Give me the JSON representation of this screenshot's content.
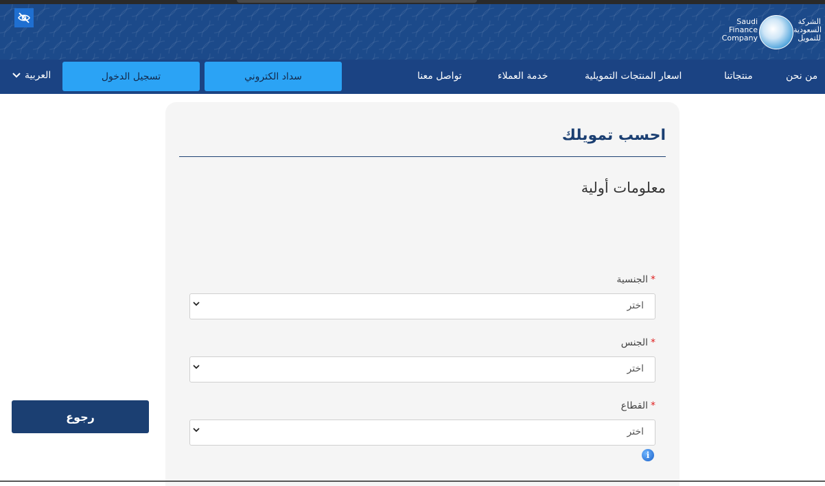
{
  "header": {
    "logo": {
      "arabic_line1": "الشركة",
      "arabic_line2": "السعودية",
      "arabic_line3": "للتمويل",
      "english_line1": "Saudi",
      "english_line2": "Finance",
      "english_line3": "Company"
    },
    "accessibility_icon": "eye-slash-icon",
    "nav": {
      "about": "من نحن",
      "products": "منتجاتنا",
      "prices": "اسعار المنتجات التمويلية",
      "customer_service": "خدمة العملاء",
      "contact": "تواصل معنا"
    },
    "pay_button": "سداد الكتروني",
    "login_button": "تسجيل الدخول",
    "language": "العربية"
  },
  "form": {
    "title": "احسب تمويلك",
    "section_title": "معلومات أولية",
    "fields": [
      {
        "label": "الجنسية",
        "required_mark": "*",
        "value": "اختر"
      },
      {
        "label": "الجنس",
        "required_mark": "*",
        "value": "اختر"
      },
      {
        "label": "القطاع",
        "required_mark": "*",
        "value": "اختر"
      }
    ],
    "info_icon": "i"
  },
  "back_button": "رجوع",
  "colors": {
    "header_bg": "#1c4a8a",
    "primary_dark": "#1b3f72",
    "button_light": "#2ba3f5",
    "required": "#e02020"
  }
}
